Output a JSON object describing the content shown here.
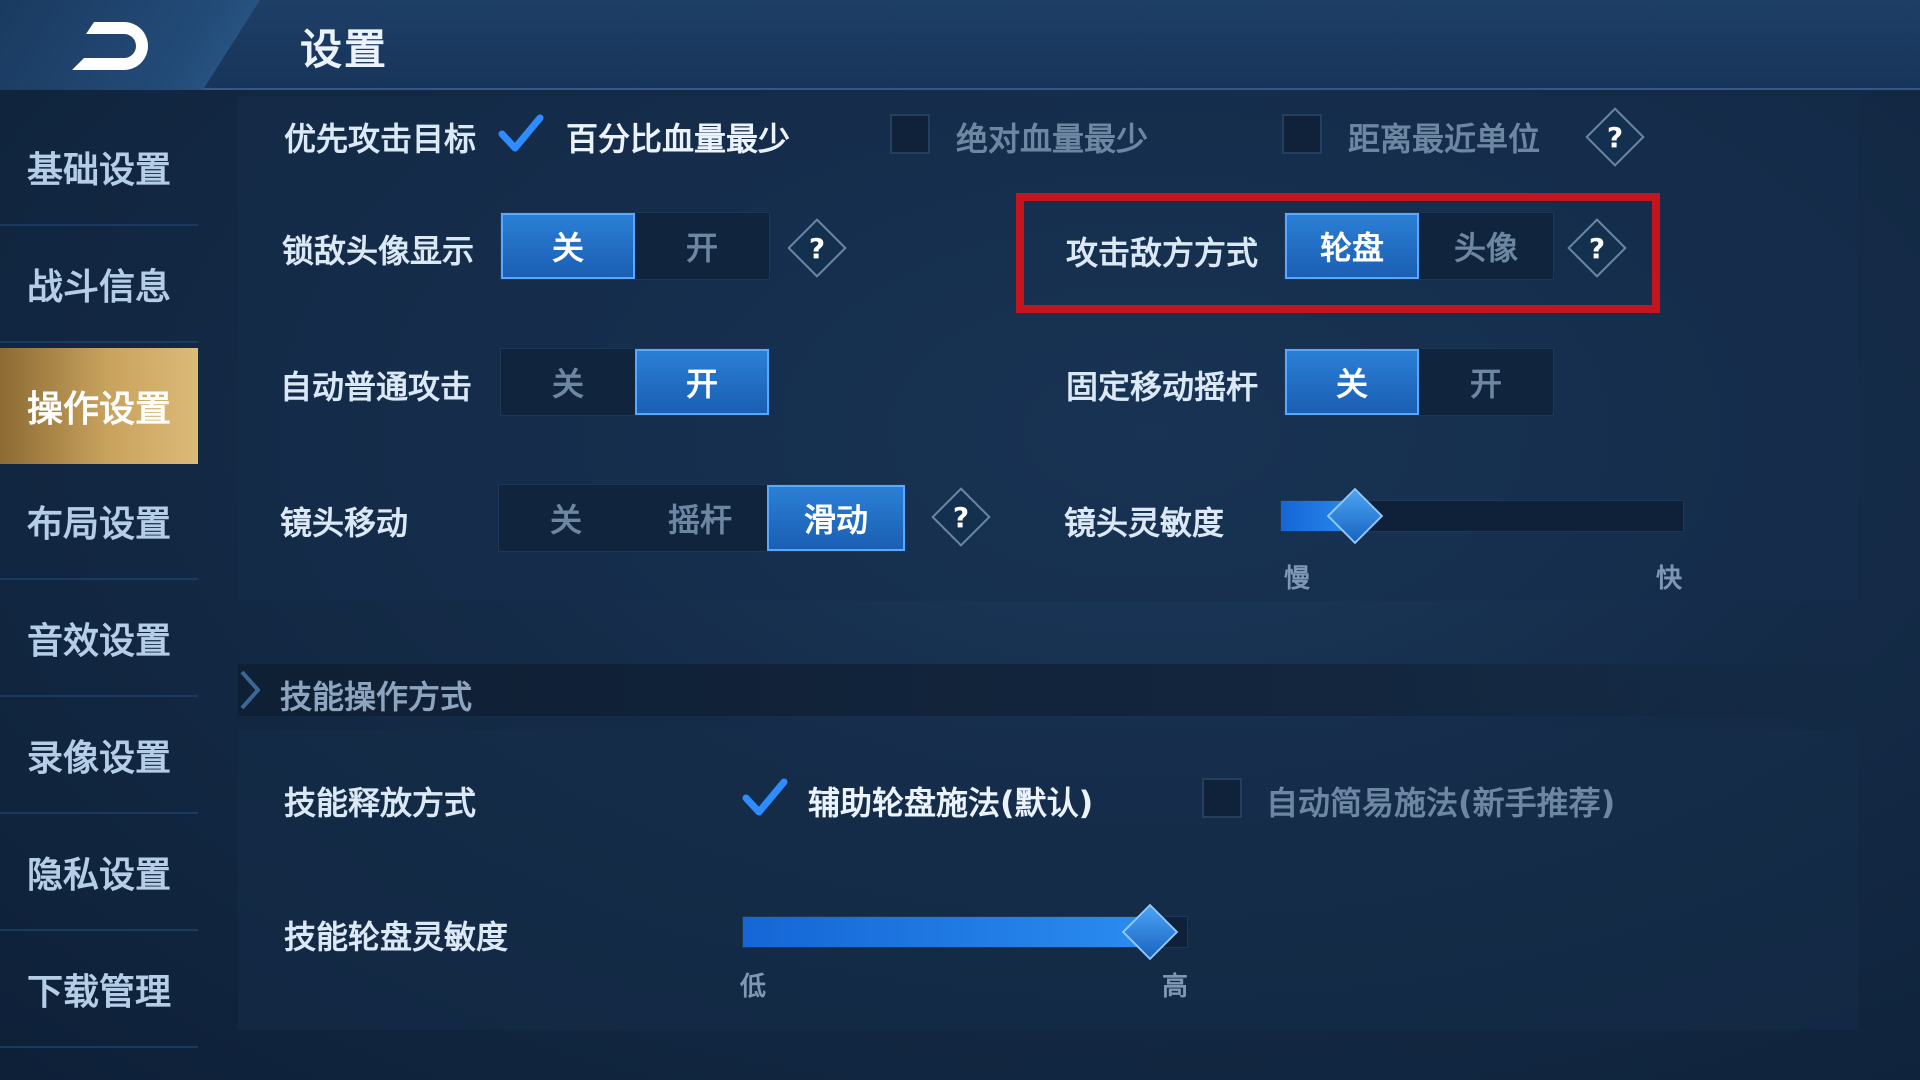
{
  "header": {
    "title": "设置"
  },
  "sidebar": {
    "items": [
      {
        "label": "基础设置",
        "active": false
      },
      {
        "label": "战斗信息",
        "active": false
      },
      {
        "label": "操作设置",
        "active": true
      },
      {
        "label": "布局设置",
        "active": false
      },
      {
        "label": "音效设置",
        "active": false
      },
      {
        "label": "录像设置",
        "active": false
      },
      {
        "label": "隐私设置",
        "active": false
      },
      {
        "label": "下载管理",
        "active": false
      }
    ]
  },
  "settings": {
    "priority_target": {
      "label": "优先攻击目标",
      "options": [
        {
          "label": "百分比血量最少",
          "checked": true
        },
        {
          "label": "绝对血量最少",
          "checked": false
        },
        {
          "label": "距离最近单位",
          "checked": false
        }
      ],
      "help": "?"
    },
    "lock_avatar": {
      "label": "锁敌头像显示",
      "options": [
        "关",
        "开"
      ],
      "selected": "关",
      "help": "?"
    },
    "attack_mode": {
      "label": "攻击敌方方式",
      "options": [
        "轮盘",
        "头像"
      ],
      "selected": "轮盘",
      "help": "?"
    },
    "auto_attack": {
      "label": "自动普通攻击",
      "options": [
        "关",
        "开"
      ],
      "selected": "开"
    },
    "fixed_joystick": {
      "label": "固定移动摇杆",
      "options": [
        "关",
        "开"
      ],
      "selected": "关"
    },
    "camera_move": {
      "label": "镜头移动",
      "options": [
        "关",
        "摇杆",
        "滑动"
      ],
      "selected": "滑动",
      "help": "?"
    },
    "camera_sensitivity": {
      "label": "镜头灵敏度",
      "min_label": "慢",
      "max_label": "快",
      "value": 0.19
    }
  },
  "skill_section": {
    "title": "技能操作方式",
    "release_mode": {
      "label": "技能释放方式",
      "options": [
        {
          "label": "辅助轮盘施法(默认)",
          "checked": true
        },
        {
          "label": "自动简易施法(新手推荐)",
          "checked": false
        }
      ]
    },
    "wheel_sensitivity": {
      "label": "技能轮盘灵敏度",
      "min_label": "低",
      "max_label": "高",
      "value": 1.0
    }
  },
  "colors": {
    "accent": "#2b7fd6",
    "active_tab": "#c9a35e",
    "highlight": "#c4141e"
  }
}
